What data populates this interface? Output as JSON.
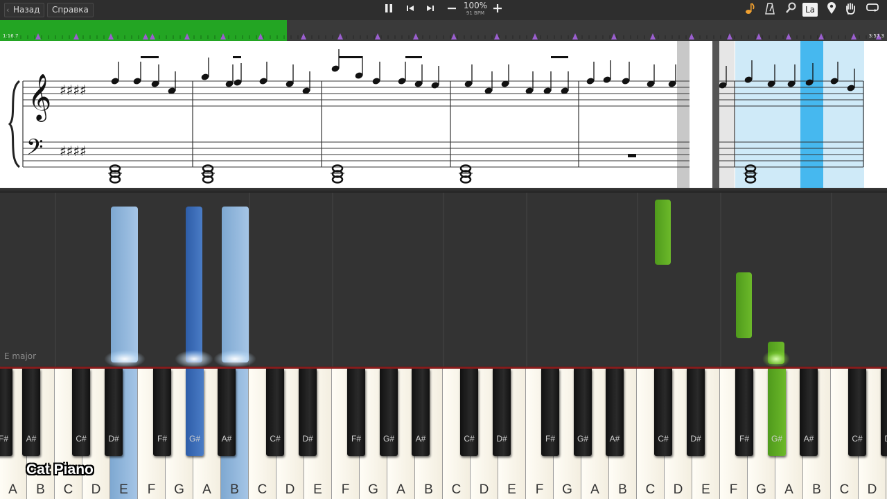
{
  "toolbar": {
    "back_label": "Назад",
    "help_label": "Справка",
    "zoom": "100%",
    "bpm": "91 BPM",
    "icons": [
      "pause-icon",
      "skip-back-icon",
      "skip-forward-icon",
      "minus-icon",
      "plus-icon",
      "note-icon",
      "metronome-icon",
      "magnifier-icon",
      "la-icon",
      "marker-icon",
      "hand-icon",
      "loop-icon"
    ],
    "la_label": "La"
  },
  "timeline": {
    "elapsed": "1:16.7",
    "total": "3:57.3",
    "progress_fraction": 0.323,
    "played_color": "#23a523",
    "marker_color": "#9b5fd0"
  },
  "piano_roll": {
    "key_signature_label": "E major",
    "right_hand_color": "#8ab3d8",
    "left_hand_color": "#5da821"
  },
  "keyboard": {
    "white_keys": [
      "A",
      "B",
      "C",
      "D",
      "E",
      "F",
      "G",
      "A",
      "B",
      "C",
      "D",
      "E",
      "F",
      "G",
      "A",
      "B",
      "C",
      "D",
      "E",
      "F",
      "G",
      "A",
      "B",
      "C",
      "D",
      "E",
      "F",
      "G",
      "A",
      "B",
      "C",
      "D"
    ],
    "black_keys": [
      "F#",
      "A#",
      "C#",
      "D#",
      "F#",
      "G#",
      "A#",
      "C#",
      "D#",
      "F#",
      "G#",
      "A#",
      "C#",
      "D#",
      "F#",
      "G#",
      "A#",
      "C#",
      "D#",
      "F#",
      "G#",
      "A#",
      "C#",
      "D#"
    ]
  },
  "overlay": {
    "brand": "Cat Piano"
  }
}
